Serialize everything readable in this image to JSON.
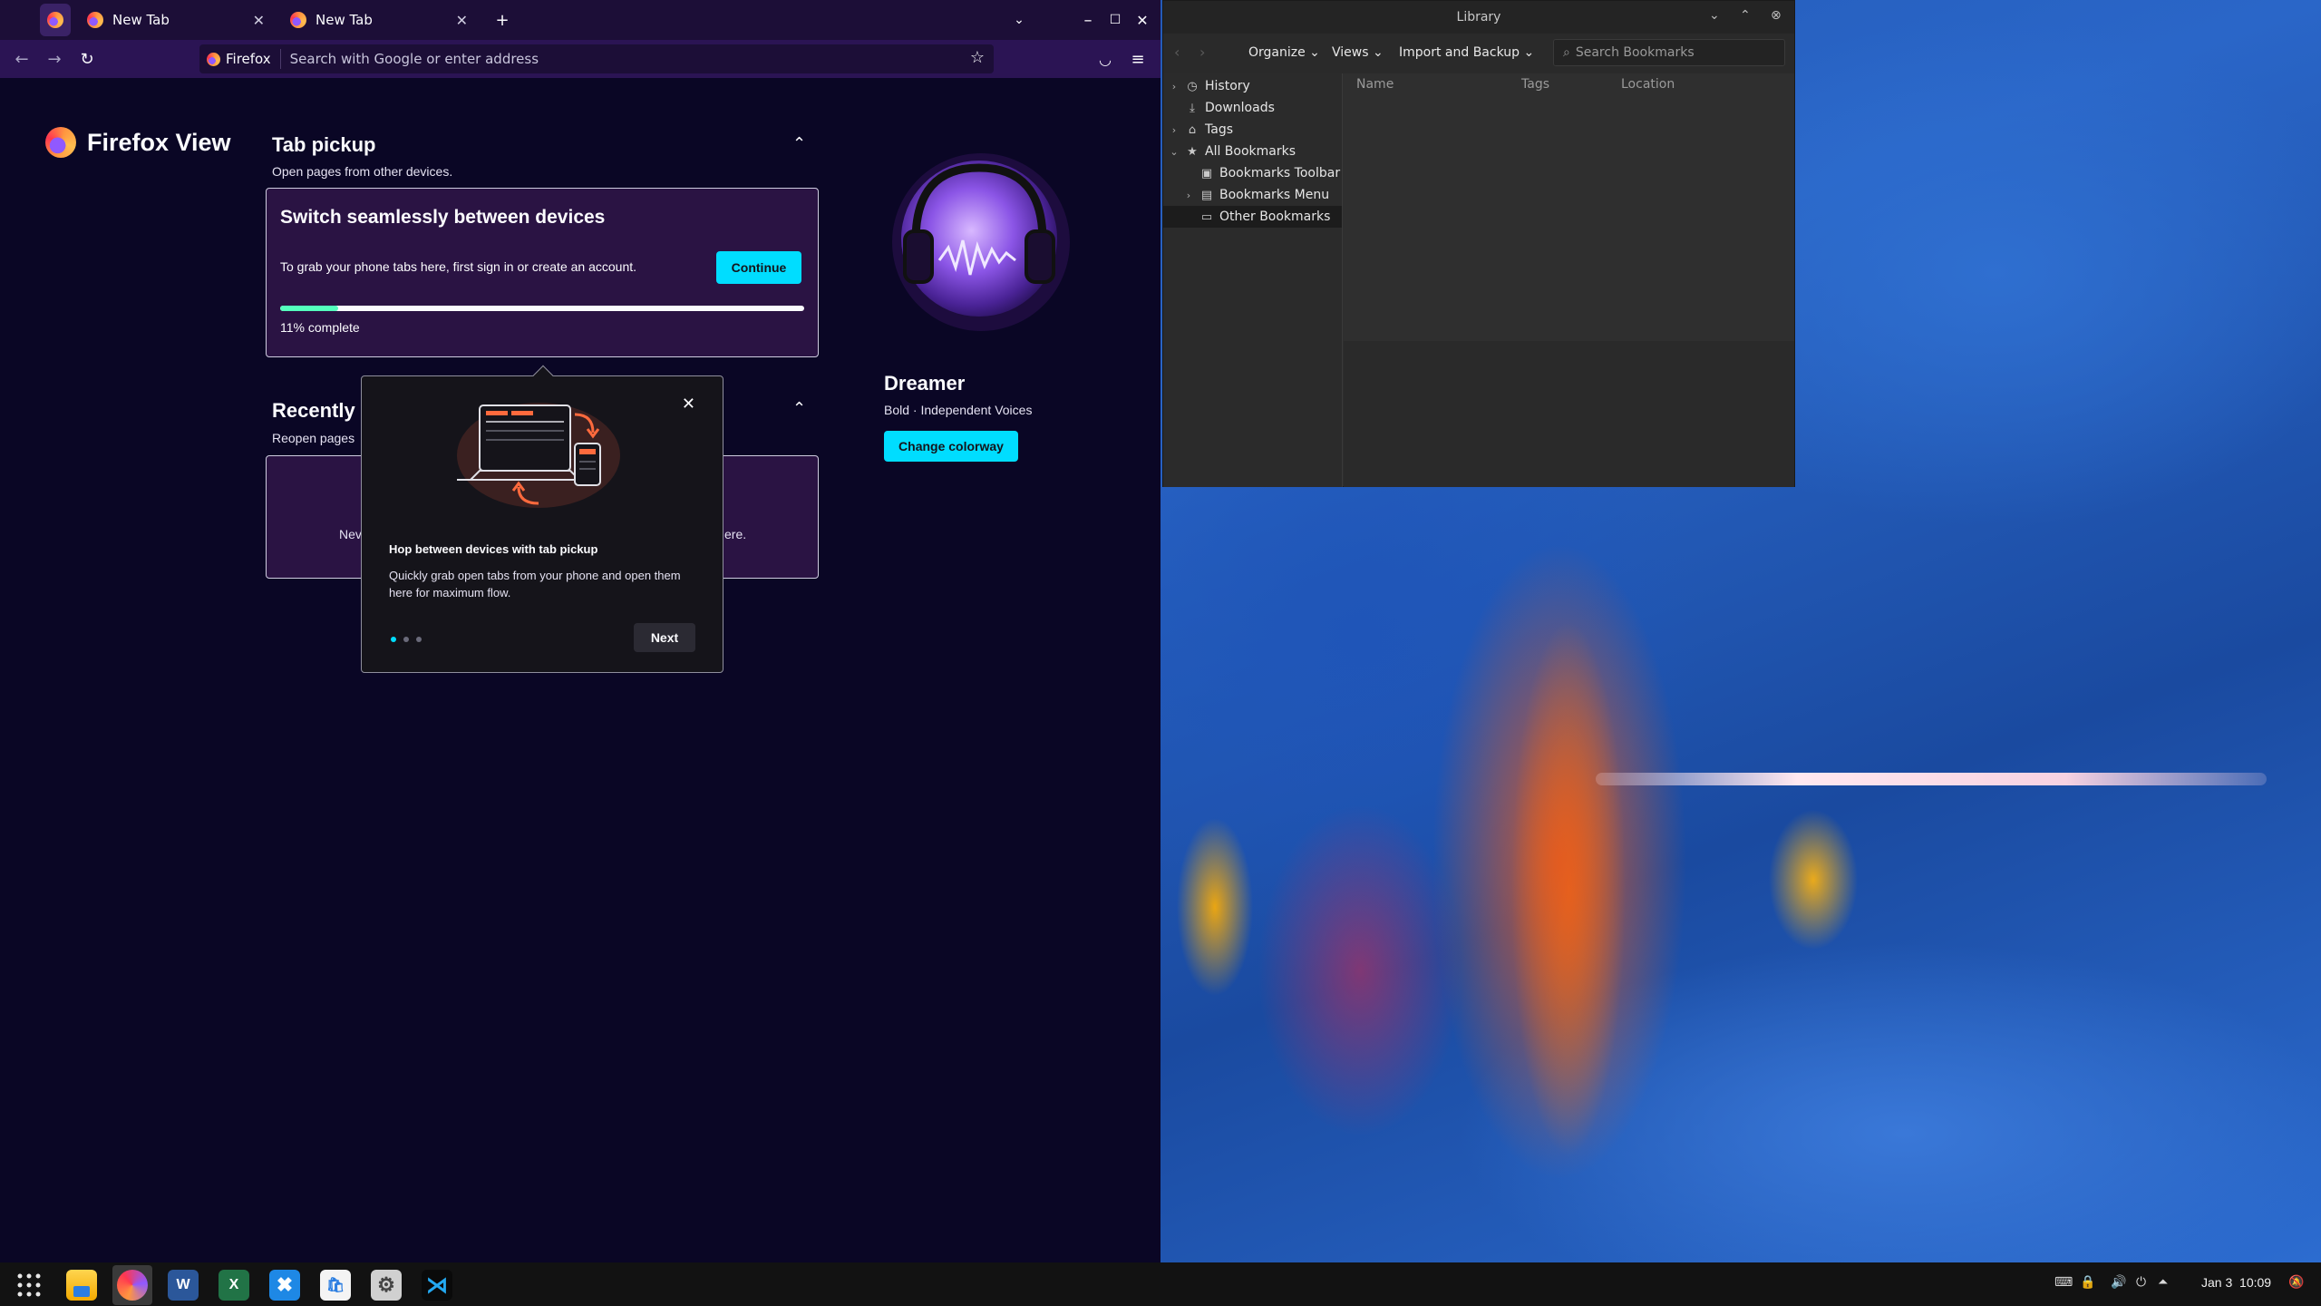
{
  "firefox": {
    "tabs": [
      {
        "label": "New Tab"
      },
      {
        "label": "New Tab"
      }
    ],
    "urlbar": {
      "identity": "Firefox",
      "placeholder": "Search with Google or enter address"
    },
    "view": {
      "brand": "Firefox View",
      "tab_pickup": {
        "title": "Tab pickup",
        "subtitle": "Open pages from other devices.",
        "card_title": "Switch seamlessly between devices",
        "card_desc": "To grab your phone tabs here, first sign in or create an account.",
        "continue_label": "Continue",
        "progress_fraction": 0.11,
        "progress_text": "11% complete"
      },
      "recently_closed": {
        "title": "Recently c",
        "subtitle": "Reopen pages",
        "empty_left": "Nev",
        "empty_right": "ere."
      },
      "popup": {
        "title": "Hop between devices with tab pickup",
        "body": "Quickly grab open tabs from your phone and open them here for maximum flow.",
        "next_label": "Next",
        "steps": 3,
        "active_step": 1
      },
      "colorway": {
        "name": "Dreamer",
        "subtitle": "Bold · Independent Voices",
        "button": "Change colorway"
      }
    }
  },
  "library": {
    "title": "Library",
    "menus": [
      "Organize",
      "Views",
      "Import and Backup"
    ],
    "search_placeholder": "Search Bookmarks",
    "tree": [
      {
        "label": "History",
        "icon": "clock-icon"
      },
      {
        "label": "Downloads",
        "icon": "download-icon"
      },
      {
        "label": "Tags",
        "icon": "tag-icon"
      },
      {
        "label": "All Bookmarks",
        "icon": "star-icon"
      },
      {
        "label": "Bookmarks Toolbar",
        "icon": "toolbar-icon"
      },
      {
        "label": "Bookmarks Menu",
        "icon": "menu-icon"
      },
      {
        "label": "Other Bookmarks",
        "icon": "folder-icon"
      }
    ],
    "columns": [
      "Name",
      "Tags",
      "Location"
    ]
  },
  "taskbar": {
    "apps": [
      "app-grid",
      "files",
      "firefox",
      "word",
      "excel",
      "xmind",
      "store",
      "settings",
      "vscode"
    ],
    "clock": {
      "date": "Jan 3",
      "time": "10:09"
    }
  },
  "colors": {
    "accent": "#00ddff",
    "progress": "#54ffbd",
    "ff_bg": "#0a0625",
    "card_bg": "#2a1343"
  }
}
